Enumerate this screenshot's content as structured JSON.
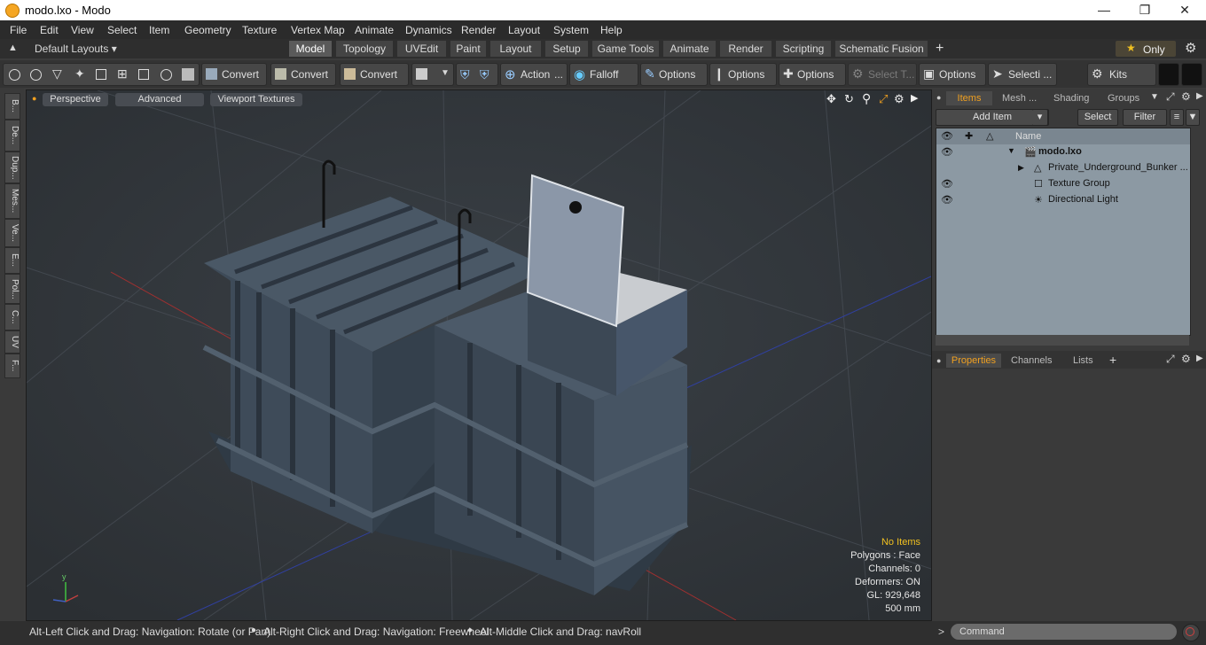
{
  "window": {
    "title": "modo.lxo - Modo"
  },
  "menubar": [
    "File",
    "Edit",
    "View",
    "Select",
    "Item",
    "Geometry",
    "Texture",
    "Vertex Map",
    "Animate",
    "Dynamics",
    "Render",
    "Layout",
    "System",
    "Help"
  ],
  "layouts": {
    "dropdown_label": "Default Layouts",
    "tabs": [
      "Model",
      "Topology",
      "UVEdit",
      "Paint",
      "Layout",
      "Setup",
      "Game Tools",
      "Animate",
      "Render",
      "Scripting",
      "Schematic Fusion"
    ],
    "active_tab": "Model",
    "only_label": "Only"
  },
  "toolbar": {
    "convert1": "Convert",
    "convert2": "Convert",
    "convert3": "Convert",
    "action": "Action",
    "falloff": "Falloff",
    "options1": "Options",
    "options2": "Options",
    "options3": "Options",
    "select_t": "Select T...",
    "options4": "Options",
    "selecti": "Selecti ...",
    "kits": "Kits"
  },
  "left_strip": [
    "B...",
    "De...",
    "Dup...",
    "Mes...",
    "Ve...",
    "E...",
    "Pol...",
    "C...",
    "UV",
    "F..."
  ],
  "viewport": {
    "tabs": [
      "Perspective",
      "Advanced",
      "Viewport Textures"
    ],
    "stats": {
      "no_items": "No Items",
      "polygons": "Polygons : Face",
      "channels": "Channels: 0",
      "deformers": "Deformers: ON",
      "gl": "GL: 929,648",
      "scale": "500 mm"
    }
  },
  "items_panel": {
    "tabs": [
      "Items",
      "Mesh ...",
      "Shading",
      "Groups"
    ],
    "active_tab": "Items",
    "add_item": "Add Item",
    "select": "Select",
    "filter": "Filter",
    "column_name": "Name",
    "rows": [
      {
        "label": "modo.lxo"
      },
      {
        "label": "Private_Underground_Bunker ..."
      },
      {
        "label": "Texture Group"
      },
      {
        "label": "Directional Light"
      }
    ]
  },
  "properties_panel": {
    "tabs": [
      "Properties",
      "Channels",
      "Lists"
    ],
    "active_tab": "Properties"
  },
  "statusbar": {
    "hint1": "Alt-Left Click and Drag: Navigation: Rotate (or Pan)",
    "hint2": "Alt-Right Click and Drag: Navigation: Freewheel",
    "hint3": "Alt-Middle Click and Drag: navRoll",
    "command_placeholder": "Command"
  },
  "colors": {
    "accent": "#f0a020",
    "viewport_bg": "#30353a",
    "bunker": "#3d4a58"
  }
}
